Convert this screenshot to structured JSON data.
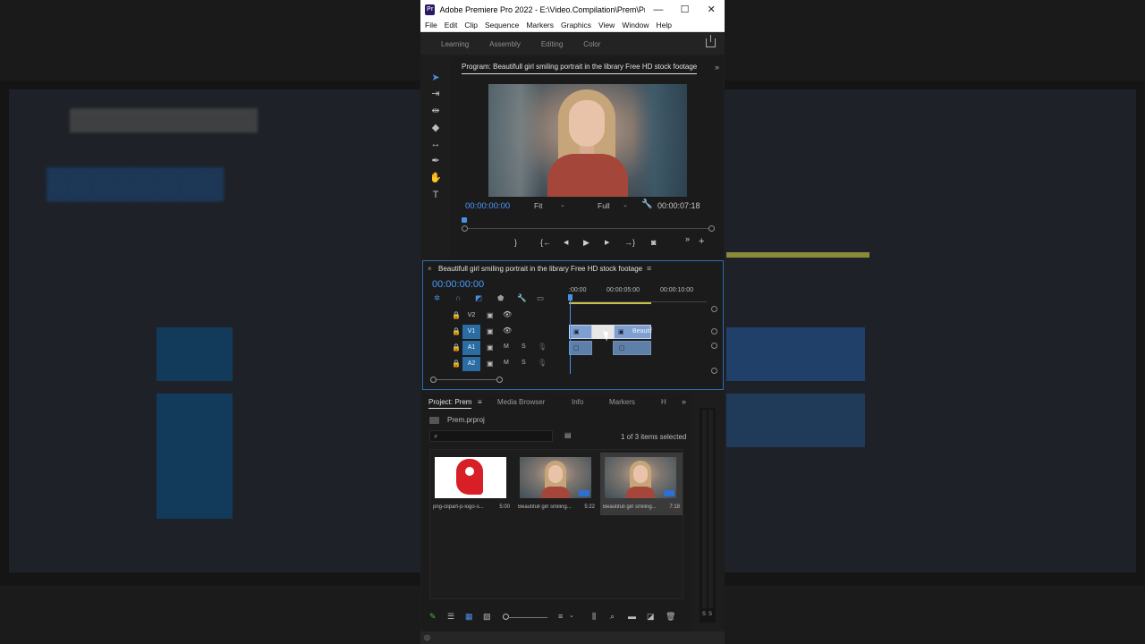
{
  "window": {
    "app_logo": "Pr",
    "title": "Adobe Premiere Pro 2022 - E:\\Video.Compilation\\Prem\\Pre...",
    "controls": {
      "minimize": "—",
      "maximize": "☐",
      "close": "✕"
    }
  },
  "menu": [
    "File",
    "Edit",
    "Clip",
    "Sequence",
    "Markers",
    "Graphics",
    "View",
    "Window",
    "Help"
  ],
  "workspaces": [
    "Learning",
    "Assembly",
    "Editing",
    "Color"
  ],
  "tools": [
    {
      "name": "selection-tool",
      "glyph": "➤"
    },
    {
      "name": "track-select-tool",
      "glyph": "⇥"
    },
    {
      "name": "ripple-edit-tool",
      "glyph": "⇹"
    },
    {
      "name": "razor-tool",
      "glyph": "◆"
    },
    {
      "name": "slip-tool",
      "glyph": "↔"
    },
    {
      "name": "pen-tool",
      "glyph": "✒"
    },
    {
      "name": "hand-tool",
      "glyph": "✋"
    },
    {
      "name": "type-tool",
      "glyph": "T"
    }
  ],
  "program_monitor": {
    "tab": "Program: Beautifull girl smiling portrait in the library Free HD stock footage",
    "timecode": "00:00:00:00",
    "zoom": "Fit",
    "resolution": "Full",
    "duration": "00:00:07:18",
    "more": "»",
    "transport": {
      "mark_out": "}",
      "go_in": "{←",
      "step_back": "◀",
      "play": "▶",
      "step_forward": "▶",
      "go_out": "→}",
      "export_frame": "◙",
      "overflow": "»",
      "add": "+"
    }
  },
  "timeline": {
    "close": "×",
    "title": "Beautifull girl smiling portrait in the library Free HD stock footage",
    "menu": "≡",
    "timecode": "00:00:00:00",
    "ruler": [
      ":00:00",
      "00:00:05:00",
      "00:00:10:00"
    ],
    "tracks": [
      {
        "id": "V2",
        "type": "video"
      },
      {
        "id": "V1",
        "type": "video"
      },
      {
        "id": "A1",
        "type": "audio"
      },
      {
        "id": "A2",
        "type": "audio"
      }
    ],
    "mute": "M",
    "solo": "S",
    "clip_label": "Beautif"
  },
  "project": {
    "tabs": [
      "Project: Prem",
      "Media Browser",
      "Info",
      "Markers",
      "H"
    ],
    "menu": "≡",
    "more": "»",
    "file": "Prem.prproj",
    "selection": "1 of 3 items selected",
    "items": [
      {
        "name": "png-clipart-p-logo-s...",
        "duration": "5:00",
        "kind": "logo"
      },
      {
        "name": "Beautifull girl smiling...",
        "duration": "5:22",
        "kind": "video"
      },
      {
        "name": "Beautifull girl smiling...",
        "duration": "7:18",
        "kind": "video",
        "selected": true
      }
    ]
  },
  "meter": {
    "left": "S",
    "right": "S"
  },
  "colors": {
    "accent": "#4a9cff",
    "track_target": "#2b6da3",
    "video_clip": "#7e9fd0",
    "audio_clip": "#5d7fa8",
    "workbar": "#c8c24b"
  }
}
